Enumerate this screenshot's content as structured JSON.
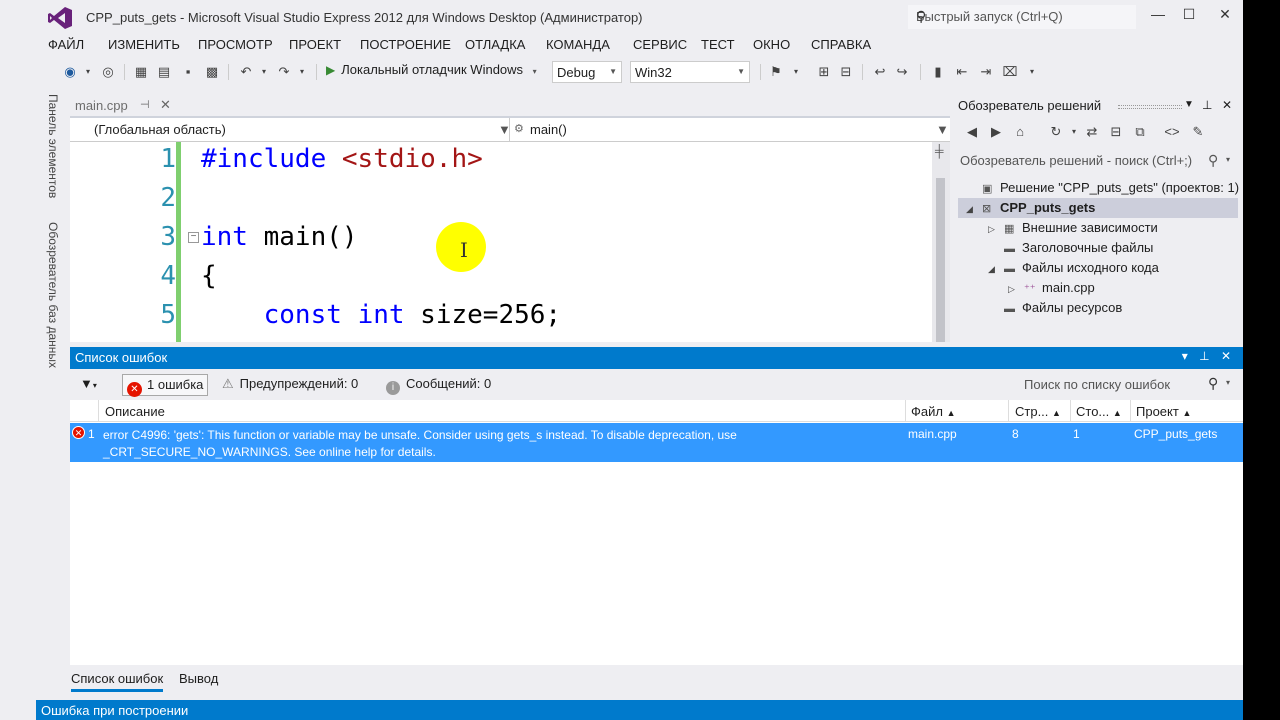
{
  "window": {
    "title": "CPP_puts_gets - Microsoft Visual Studio Express 2012 для Windows Desktop (Администратор)",
    "quick_launch_placeholder": "Быстрый запуск (Ctrl+Q)",
    "accent_color": "#007acc"
  },
  "menu": [
    "ФАЙЛ",
    "ИЗМЕНИТЬ",
    "ПРОСМОТР",
    "ПРОЕКТ",
    "ПОСТРОЕНИЕ",
    "ОТЛАДКА",
    "КОМАНДА",
    "СЕРВИС",
    "ТЕСТ",
    "ОКНО",
    "СПРАВКА"
  ],
  "toolbar": {
    "debugger_label": "Локальный отладчик Windows",
    "configuration": "Debug",
    "platform": "Win32"
  },
  "side_strip": {
    "toolbox": "Панель элементов",
    "db_explorer": "Обозреватель баз данных"
  },
  "editor": {
    "tab_name": "main.cpp",
    "scope_left": "(Глобальная область)",
    "scope_right": "main()",
    "lines": [
      {
        "n": "1",
        "parts": [
          {
            "t": "#include ",
            "c": "pp"
          },
          {
            "t": "<stdio.h>",
            "c": "str"
          }
        ]
      },
      {
        "n": "2",
        "parts": []
      },
      {
        "n": "3",
        "parts": [
          {
            "t": "int",
            "c": "kw"
          },
          {
            "t": " main()",
            "c": ""
          }
        ]
      },
      {
        "n": "4",
        "parts": [
          {
            "t": "{",
            "c": ""
          }
        ]
      },
      {
        "n": "5",
        "parts": [
          {
            "t": "    ",
            "c": ""
          },
          {
            "t": "const",
            "c": "kw"
          },
          {
            "t": " ",
            "c": ""
          },
          {
            "t": "int",
            "c": "kw"
          },
          {
            "t": " size=256;",
            "c": ""
          }
        ]
      }
    ]
  },
  "solution_explorer": {
    "title": "Обозреватель решений",
    "search_placeholder": "Обозреватель решений - поиск (Ctrl+;)",
    "tree": [
      {
        "label": "Решение \"CPP_puts_gets\"  (проектов: 1)",
        "expander": "",
        "icon": "solution-icon",
        "selected": false
      },
      {
        "label": "CPP_puts_gets",
        "expander": "◢",
        "icon": "project-icon",
        "selected": true
      },
      {
        "label": "Внешние зависимости",
        "expander": "▷",
        "icon": "dependencies-icon",
        "selected": false
      },
      {
        "label": "Заголовочные файлы",
        "expander": "",
        "icon": "folder-icon",
        "selected": false
      },
      {
        "label": "Файлы исходного кода",
        "expander": "◢",
        "icon": "folder-icon",
        "selected": false
      },
      {
        "label": "main.cpp",
        "expander": "▷",
        "icon": "cpp-file-icon",
        "selected": false
      },
      {
        "label": "Файлы ресурсов",
        "expander": "",
        "icon": "folder-icon",
        "selected": false
      }
    ]
  },
  "error_list": {
    "title": "Список ошибок",
    "errors_filter": "1 ошибка",
    "warnings_filter": "Предупреждений: 0",
    "messages_filter": "Сообщений: 0",
    "search_placeholder": "Поиск по списку ошибок",
    "columns": {
      "description": "Описание",
      "file": "Файл",
      "line": "Стр...",
      "column": "Сто...",
      "project": "Проект"
    },
    "rows": [
      {
        "index": "1",
        "description": "error C4996: 'gets': This function or variable may be unsafe. Consider using gets_s instead. To disable deprecation, use _CRT_SECURE_NO_WARNINGS. See online help for details.",
        "file": "main.cpp",
        "line": "8",
        "column": "1",
        "project": "CPP_puts_gets"
      }
    ]
  },
  "bottom_tabs": [
    "Список ошибок",
    "Вывод"
  ],
  "status": "Ошибка при построении"
}
